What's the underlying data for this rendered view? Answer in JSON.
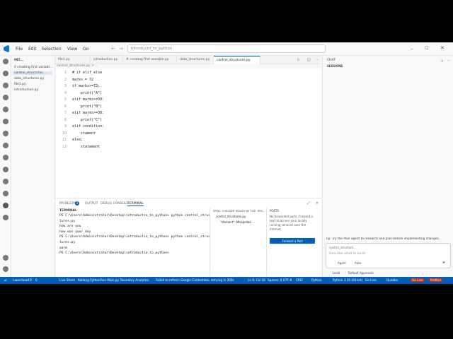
{
  "titlebar": {
    "menus": [
      "File",
      "Edit",
      "Selection",
      "View",
      "Go"
    ],
    "search_value": "introducto_to_python"
  },
  "sidebar": {
    "header": "INT...",
    "items": [
      "if creating first variabl...",
      "control_structures...",
      "data_structures.py",
      "file1.py",
      "introduction.py"
    ]
  },
  "tabs": [
    {
      "label": "file1.py",
      "active": false
    },
    {
      "label": "introduction.py",
      "active": false
    },
    {
      "label": "# creating first variable.py",
      "active": false
    },
    {
      "label": "data_structures.py",
      "active": false
    },
    {
      "label": "control_structures.py",
      "active": true
    }
  ],
  "breadcrumb": "control_structures.py > ...",
  "editor": {
    "lines": [
      {
        "n": "1",
        "html": "# if elif else"
      },
      {
        "n": "2",
        "html": "marks = 72"
      },
      {
        "n": "3",
        "html": "if marks>=72:"
      },
      {
        "n": "4",
        "html": "    print(\"A\")"
      },
      {
        "n": "5",
        "html": "elif marks>=50:"
      },
      {
        "n": "6",
        "html": "    print(\"B\")"
      },
      {
        "n": "7",
        "html": "elif marks>=30:"
      },
      {
        "n": "8",
        "html": "    print(\"C\")"
      },
      {
        "n": "9",
        "html": "elif condition:"
      },
      {
        "n": "10",
        "html": "    stament"
      },
      {
        "n": "11",
        "html": "else:"
      },
      {
        "n": "12",
        "html": "    statement"
      }
    ]
  },
  "panel": {
    "tabs": [
      "PROBLEMS",
      "OUTPUT",
      "DEBUG CONSOLE",
      "TERMINAL"
    ],
    "problems_count": "3",
    "active_tab": "TERMINAL",
    "terminal_label": "TERMINAL",
    "terminal_lines": [
      "PS C:\\Users\\Administrator\\Desktop\\introductio_to_python> python control_struc",
      "tures.py",
      "how are you",
      "how was your day",
      "PS C:\\Users\\Administrator\\Desktop\\introductio_to_python> python control_struc",
      "tures.py",
      "warm",
      "PS C:\\Users\\Administrator\\Desktop\\introductio_to_python> "
    ],
    "spell_header": "SPELL CHECKER ISSUES BY FILE: SPE...",
    "spell_items": [
      "control_structures.py",
      "\"stament\": Misspelled ..."
    ],
    "ports_header": "PORTS",
    "ports_text": "No forwarded ports. Forward a port to access your locally running services over the internet.",
    "ports_button": "Forward a Port"
  },
  "aux": {
    "chat_title": "CHAT",
    "sessions": "SESSIONS",
    "tip": "Tip: Try the Plan agent to research and plan before implementing changes.",
    "context": "control_structure...",
    "placeholder": "Describe what to build",
    "agent": "Agent",
    "auto": "Auto",
    "local": "Local",
    "approvals": "Default Approvals"
  },
  "status": {
    "left": [
      "Launchpad",
      "0",
      "0",
      "Live Share",
      "Kotlang Python",
      "Run Main.py",
      "Roundary Analytics"
    ],
    "warning": "Failed to refresh Google Credentials, retrying in 300s",
    "right": [
      "Ln 9, Col 16",
      "Spaces: 4",
      "UTF-8",
      "CRLF",
      "Python",
      "Python 3.10 (64-bit)",
      "Go Live",
      "Quokka",
      "Go Live",
      "Prettier"
    ]
  },
  "colors": {
    "accent": "#005fb8",
    "status_bg": "#005fb8",
    "error": "#c72e0f"
  }
}
